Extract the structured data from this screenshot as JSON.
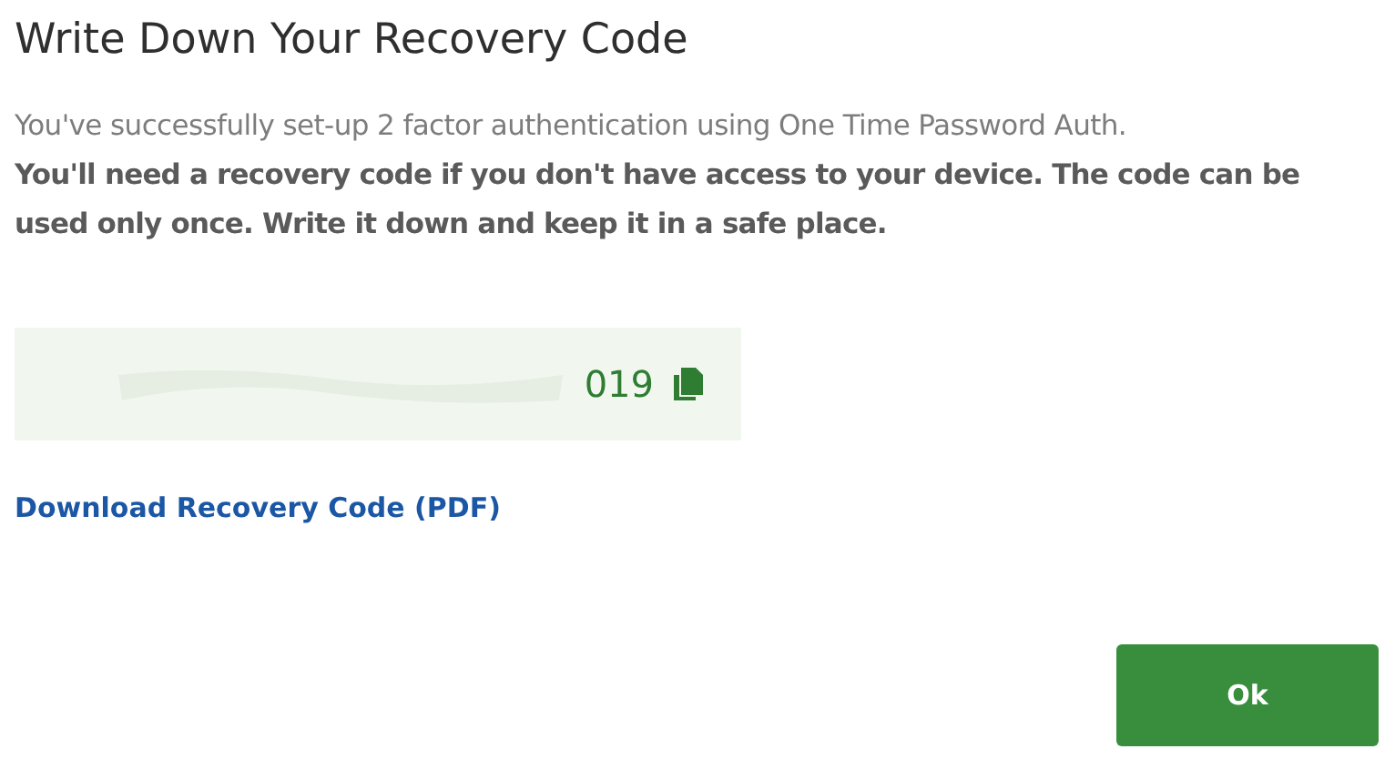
{
  "dialog": {
    "title": "Write Down Your Recovery Code",
    "intro": "You've successfully set-up 2 factor authentication using One Time Password Auth.",
    "note": "You'll need a recovery code if you don't have access to your device. The code can be used only once. Write it down and keep it in a safe place.",
    "code": {
      "visible_text": "019",
      "redacted": true
    },
    "download_link": "Download Recovery Code (PDF)",
    "buttons": [
      "Ok"
    ]
  }
}
